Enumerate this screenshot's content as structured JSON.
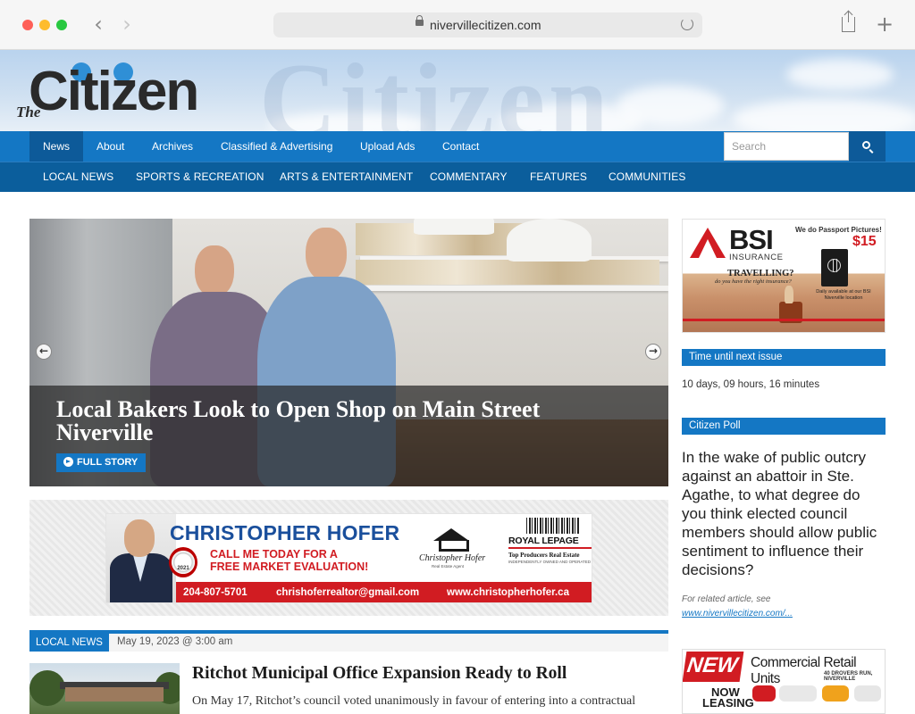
{
  "browser": {
    "url": "nivervillecitizen.com"
  },
  "site": {
    "logo_small": "The",
    "logo_main": "Citizen",
    "main_nav": [
      {
        "label": "News",
        "active": true
      },
      {
        "label": "About"
      },
      {
        "label": "Archives"
      },
      {
        "label": "Classified & Advertising"
      },
      {
        "label": "Upload Ads"
      },
      {
        "label": "Contact"
      }
    ],
    "search_placeholder": "Search",
    "sub_nav": [
      {
        "label": "LOCAL NEWS"
      },
      {
        "label": "SPORTS & RECREATION"
      },
      {
        "label": "ARTS & ENTERTAINMENT"
      },
      {
        "label": "COMMENTARY"
      },
      {
        "label": "FEATURES"
      },
      {
        "label": "COMMUNITIES"
      }
    ]
  },
  "hero": {
    "title": "Local Bakers Look to Open Shop on Main Street Niverville",
    "button": "FULL STORY"
  },
  "banner_ad": {
    "name": "CHRISTOPHER HOFER",
    "badge_year": "2021",
    "cta_line1": "CALL ME TODAY FOR A",
    "cta_line2": "FREE MARKET EVALUATION!",
    "logo_name": "Christopher Hofer",
    "logo_sub": "Real Estate Agent",
    "brokerage": "ROYAL LEPAGE",
    "brokerage_sub": "Top Producers Real Estate",
    "brokerage_sub2": "INDEPENDENTLY OWNED AND OPERATED",
    "phone": "204-807-5701",
    "email": "chrishoferrealtor@gmail.com",
    "website": "www.christopherhofer.ca"
  },
  "local_news": {
    "tag": "LOCAL NEWS",
    "date": "May 19, 2023 @ 3:00 am",
    "title": "Ritchot Municipal Office Expansion Ready to Roll",
    "excerpt": "On May 17, Ritchot’s council voted unanimously in favour of entering into a contractual"
  },
  "sidebar": {
    "bsi_ad": {
      "brand": "BSI",
      "insurance": "INSURANCE",
      "passport": "We do Passport Pictures!",
      "price": "$15",
      "travelling": "TRAVELLING?",
      "question": "do you have the right insurance?",
      "note": "Daily available at our BSI Niverville location"
    },
    "countdown_heading": "Time until next issue",
    "countdown_value": "10 days, 09 hours, 16 minutes",
    "poll_heading": "Citizen Poll",
    "poll_question": "In the wake of public outcry against an abattoir in Ste. Agathe, to what degree do you think elected council members should allow public sentiment to influence their decisions?",
    "poll_note": "For related article, see",
    "poll_link": "www.nivervillecitizen.com/...",
    "retail_ad": {
      "new": "NEW",
      "title": "Commercial Retail Units",
      "address": "40 DROVERS RUN, NIVERVILLE",
      "now": "NOW",
      "leasing": "LEASING"
    }
  },
  "colors": {
    "brand_blue": "#1477c4",
    "dark_blue": "#0b5e9c",
    "accent_red": "#d11c22"
  }
}
